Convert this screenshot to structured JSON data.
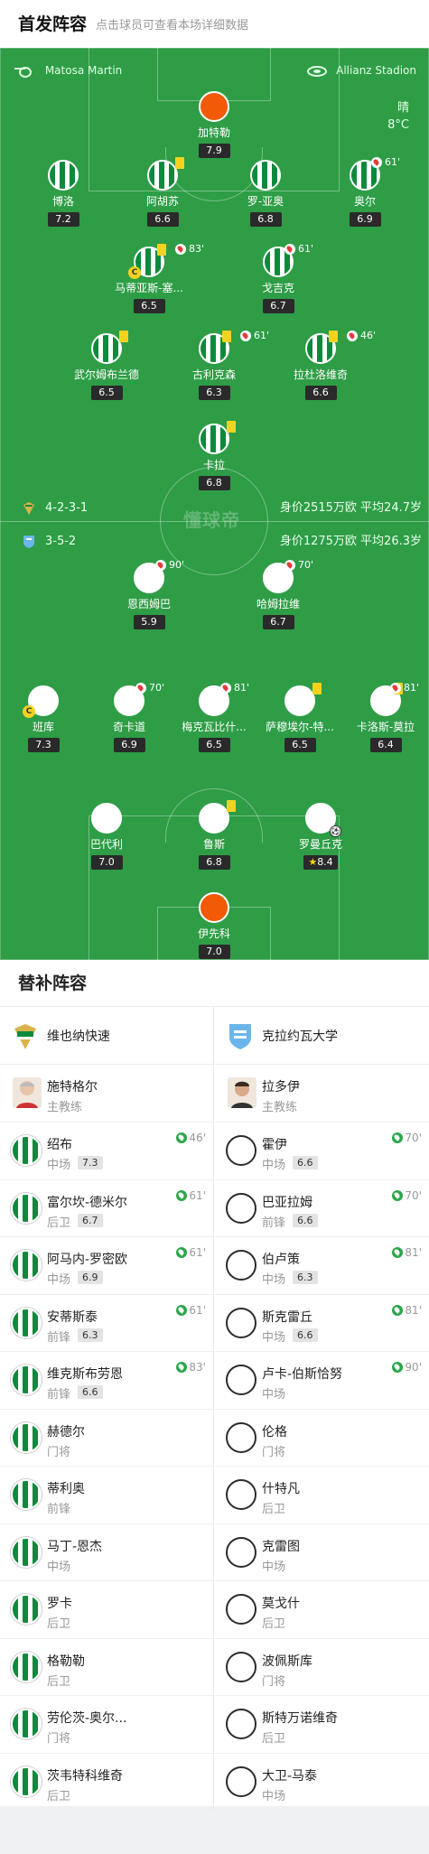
{
  "header": {
    "title": "首发阵容",
    "subtitle": "点击球员可查看本场详细数据"
  },
  "pitch": {
    "referee": "Matosa Martin",
    "stadium": "Allianz Stadion",
    "weather": "晴",
    "temp": "8°C",
    "home_formation": "4-2-3-1",
    "home_value": "身价2515万欧 平均24.7岁",
    "away_formation": "3-5-2",
    "away_value": "身价1275万欧 平均26.3岁",
    "watermark": "懂球帝"
  },
  "home": [
    {
      "name": "加特勒",
      "rating": "7.9"
    },
    {
      "name": "博洛",
      "rating": "7.2"
    },
    {
      "name": "阿胡苏",
      "rating": "6.6"
    },
    {
      "name": "罗-亚奥",
      "rating": "6.8"
    },
    {
      "name": "奥尔",
      "rating": "6.9",
      "sub": "61'"
    },
    {
      "name": "马蒂亚斯-塞...",
      "rating": "6.5",
      "sub": "83'"
    },
    {
      "name": "戈吉克",
      "rating": "6.7",
      "sub": "61'"
    },
    {
      "name": "武尔姆布兰德",
      "rating": "6.5"
    },
    {
      "name": "古利克森",
      "rating": "6.3",
      "sub": "61'"
    },
    {
      "name": "拉杜洛维奇",
      "rating": "6.6",
      "sub": "46'"
    },
    {
      "name": "卡拉",
      "rating": "6.8"
    }
  ],
  "away": [
    {
      "name": "恩西姆巴",
      "rating": "5.9",
      "sub": "90'"
    },
    {
      "name": "哈姆拉维",
      "rating": "6.7",
      "sub": "70'"
    },
    {
      "name": "班库",
      "rating": "7.3"
    },
    {
      "name": "奇卡道",
      "rating": "6.9",
      "sub": "70'"
    },
    {
      "name": "梅克瓦比什...",
      "rating": "6.5",
      "sub": "81'"
    },
    {
      "name": "萨穆埃尔-特...",
      "rating": "6.5"
    },
    {
      "name": "卡洛斯-莫拉",
      "rating": "6.4",
      "sub": "81'"
    },
    {
      "name": "巴代利",
      "rating": "7.0"
    },
    {
      "name": "鲁斯",
      "rating": "6.8"
    },
    {
      "name": "罗曼丘克",
      "rating": "8.4"
    },
    {
      "name": "伊先科",
      "rating": "7.0"
    }
  ],
  "subs": {
    "title": "替补阵容",
    "home_team": "维也纳快速",
    "away_team": "克拉约瓦大学",
    "home_coach": "施特格尔",
    "away_coach": "拉多伊",
    "coach_role": "主教练",
    "home_list": [
      {
        "name": "绍布",
        "pos": "中场",
        "rating": "7.3",
        "in": "46'"
      },
      {
        "name": "富尔坎-德米尔",
        "pos": "后卫",
        "rating": "6.7",
        "in": "61'"
      },
      {
        "name": "阿马内-罗密欧",
        "pos": "中场",
        "rating": "6.9",
        "in": "61'"
      },
      {
        "name": "安蒂斯泰",
        "pos": "前锋",
        "rating": "6.3",
        "in": "61'"
      },
      {
        "name": "维克斯布劳恩",
        "pos": "前锋",
        "rating": "6.6",
        "in": "83'"
      },
      {
        "name": "赫德尔",
        "pos": "门将"
      },
      {
        "name": "蒂利奥",
        "pos": "前锋"
      },
      {
        "name": "马丁-恩杰",
        "pos": "中场"
      },
      {
        "name": "罗卡",
        "pos": "后卫"
      },
      {
        "name": "格勒勒",
        "pos": "后卫"
      },
      {
        "name": "劳伦茨-奥尔...",
        "pos": "门将"
      },
      {
        "name": "茨韦特科维奇",
        "pos": "后卫"
      }
    ],
    "away_list": [
      {
        "name": "霍伊",
        "pos": "中场",
        "rating": "6.6",
        "in": "70'"
      },
      {
        "name": "巴亚拉姆",
        "pos": "前锋",
        "rating": "6.6",
        "in": "70'"
      },
      {
        "name": "伯卢策",
        "pos": "中场",
        "rating": "6.3",
        "in": "81'"
      },
      {
        "name": "斯克雷丘",
        "pos": "中场",
        "rating": "6.6",
        "in": "81'"
      },
      {
        "name": "卢卡-伯斯恰努",
        "pos": "中场",
        "in": "90'"
      },
      {
        "name": "伦格",
        "pos": "门将"
      },
      {
        "name": "什特凡",
        "pos": "后卫"
      },
      {
        "name": "克雷图",
        "pos": "中场"
      },
      {
        "name": "莫戈什",
        "pos": "后卫"
      },
      {
        "name": "波佩斯库",
        "pos": "门将"
      },
      {
        "name": "斯特万诺维奇",
        "pos": "后卫"
      },
      {
        "name": "大卫-马泰",
        "pos": "中场"
      }
    ]
  }
}
